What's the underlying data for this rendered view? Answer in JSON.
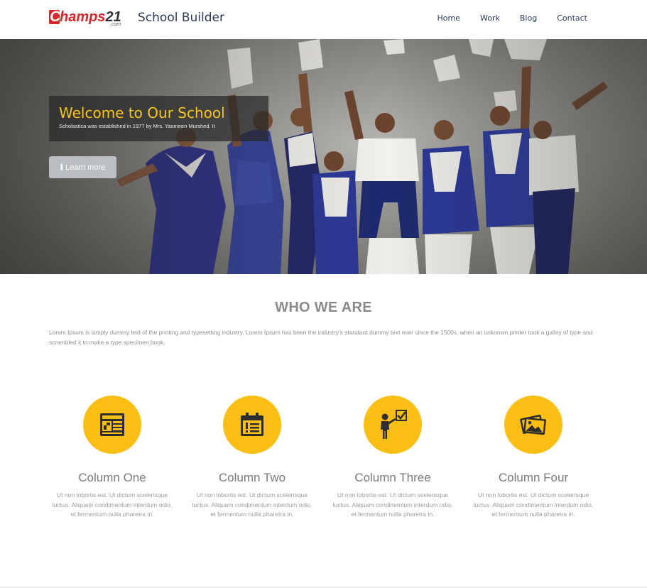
{
  "header": {
    "logo": {
      "brand_c": "C",
      "brand_rest": "hamps",
      "brand_num": "21",
      "brand_suffix": ".com"
    },
    "site_title": "School Builder",
    "nav": [
      {
        "label": "Home"
      },
      {
        "label": "Work"
      },
      {
        "label": "Blog"
      },
      {
        "label": "Contact"
      }
    ]
  },
  "hero": {
    "title": "Welcome to Our School",
    "subtitle": "Scholastica was established in 1977 by Mrs. Yasmeen Murshed. It",
    "button_label": "Learn more",
    "button_icon": "info-icon"
  },
  "about": {
    "title": "WHO WE ARE",
    "text": "Lorem Ipsum is simply dummy text of the printing and typesetting industry. Lorem Ipsum has been the industry's standard dummy text ever since the 1500s, when an unknown printer took a galley of type and scrambled it to make a type specimen book."
  },
  "columns": [
    {
      "title": "Column One",
      "icon": "newspaper-icon",
      "text": "Ut non lobortis est. Ut dictum scelerisque luctus. Aliquam condimentum interdum odio, et fermentum nulla pharetra in."
    },
    {
      "title": "Column Two",
      "icon": "calendar-list-icon",
      "text": "Ut non lobortis est. Ut dictum scelerisque luctus. Aliquam condimentum interdum odio, et fermentum nulla pharetra in."
    },
    {
      "title": "Column Three",
      "icon": "presenter-icon",
      "text": "Ut non lobortis est. Ut dictum scelerisque luctus. Aliquam condimentum interdum odio, et fermentum nulla pharetra in."
    },
    {
      "title": "Column Four",
      "icon": "photos-icon",
      "text": "Ut non lobortis est. Ut dictum scelerisque luctus. Aliquam condimentum interdum odio, et fermentum nulla pharetra in."
    }
  ],
  "colors": {
    "accent": "#fbbf14",
    "hero_title": "#f7c51e",
    "nav": "#2b3b57",
    "logo_red": "#d7262a"
  }
}
